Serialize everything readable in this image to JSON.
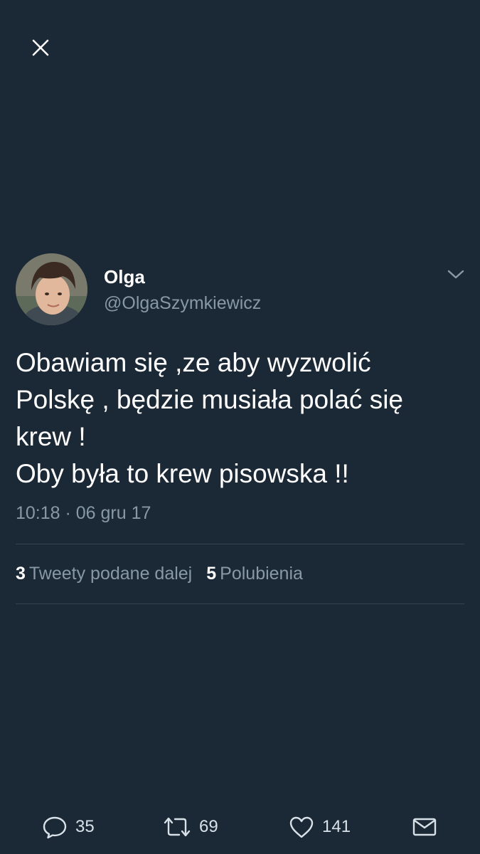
{
  "close": {
    "icon": "close-icon"
  },
  "tweet": {
    "display_name": "Olga",
    "handle": "@OlgaSzymkiewicz",
    "text_lines": [
      "Obawiam się ,ze aby wyzwolić",
      "Polskę , będzie musiała polać się",
      "krew !",
      "Oby była to krew pisowska !!"
    ],
    "timestamp": "10:18 · 06 gru 17"
  },
  "stats": {
    "retweets_count": "3",
    "retweets_label": "Tweety podane dalej",
    "likes_count": "5",
    "likes_label": "Polubienia"
  },
  "actions": {
    "reply_count": "35",
    "retweet_count": "69",
    "like_count": "141"
  },
  "colors": {
    "background": "#1b2836",
    "secondary_text": "#8899a6",
    "divider": "#38444d"
  }
}
